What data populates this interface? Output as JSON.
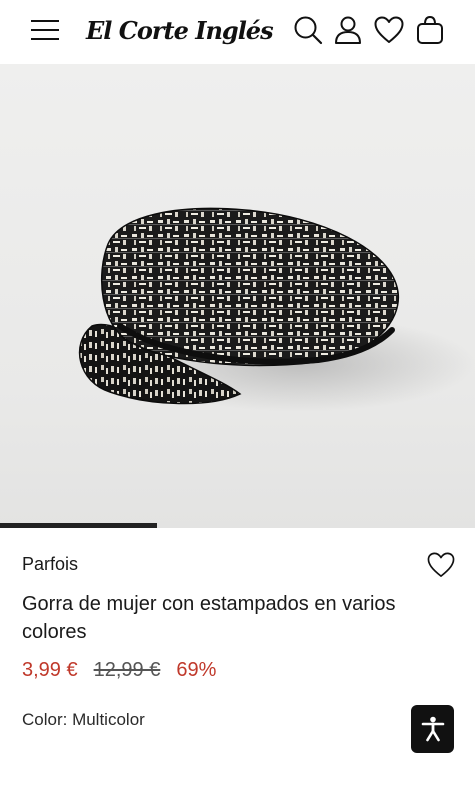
{
  "header": {
    "logo_text": "El Corte Inglés",
    "icons": [
      "menu-icon",
      "search-icon",
      "user-icon",
      "heart-icon",
      "shopping-bag-icon"
    ]
  },
  "gallery": {
    "image_alt": "Gorra de mujer con estampados en varios colores",
    "active_slide_progress": 0.33
  },
  "product": {
    "brand": "Parfois",
    "title": "Gorra de mujer con estampados en varios colores",
    "price_current": "3,99 €",
    "price_old": "12,99 €",
    "discount": "69%",
    "color_label": "Color: Multicolor"
  },
  "colors": {
    "sale": "#c0392b",
    "text": "#1a1a1a",
    "background": "#ffffff"
  }
}
